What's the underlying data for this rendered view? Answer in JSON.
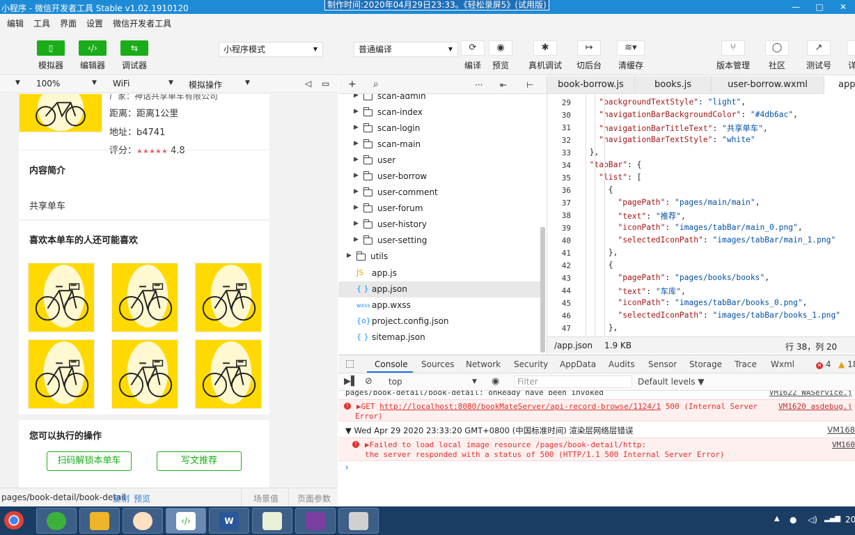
{
  "window": {
    "title": "小程序 - 微信开发者工具 Stable v1.02.1910120",
    "recording_banner": "制作时间:2020年04月29日23:33。《轻松录屏5》(试用版)",
    "controls": [
      "—",
      "□",
      "✕"
    ]
  },
  "menu": [
    "编辑",
    "工具",
    "界面",
    "设置",
    "微信开发者工具"
  ],
  "toolbar": {
    "simulator": "模拟器",
    "editor": "编辑器",
    "debugger": "调试器",
    "mode_select": "小程序模式",
    "compile_select": "普通编译",
    "compile": "编译",
    "preview": "预览",
    "remote_debug": "真机调试",
    "background": "切后台",
    "clear_cache": "清缓存",
    "version_mgmt": "版本管理",
    "community": "社区",
    "test_account": "测试号",
    "cut": "详"
  },
  "simbar": {
    "zoom": "100%",
    "network": "WiFi",
    "operation": "模拟操作"
  },
  "phone": {
    "top_partial": "厂家：神话共享单车有限公司",
    "distance": "距离：距离1公里",
    "address": "地址：b4741",
    "rating_label": "评分：",
    "rating_stars": "★★★★★",
    "rating_value": "4.8",
    "intro_title": "内容简介",
    "intro_text": "共享单车",
    "like_title": "喜欢本单车的人还可能喜欢",
    "actions_title": "您可以执行的操作",
    "btn_unlock": "扫码解锁本单车",
    "btn_write": "写文推荐",
    "brand_color": "#ffd900"
  },
  "simstatus": {
    "path": "pages/book-detail/book-detail",
    "copy": "复制",
    "preview": "预览",
    "scene": "场景值",
    "params": "页面参数"
  },
  "tree": {
    "toolbar_add": "+",
    "toolbar_search": "⌕",
    "toolbar_more": "···",
    "items": [
      {
        "name": "scan-admin",
        "type": "folder"
      },
      {
        "name": "scan-index",
        "type": "folder"
      },
      {
        "name": "scan-login",
        "type": "folder"
      },
      {
        "name": "scan-main",
        "type": "folder"
      },
      {
        "name": "user",
        "type": "folder"
      },
      {
        "name": "user-borrow",
        "type": "folder"
      },
      {
        "name": "user-comment",
        "type": "folder"
      },
      {
        "name": "user-forum",
        "type": "folder"
      },
      {
        "name": "user-history",
        "type": "folder"
      },
      {
        "name": "user-setting",
        "type": "folder"
      },
      {
        "name": "utils",
        "type": "folder"
      },
      {
        "name": "app.js",
        "type": "js",
        "icon": "JS"
      },
      {
        "name": "app.json",
        "type": "json",
        "icon": "{ }"
      },
      {
        "name": "app.wxss",
        "type": "wxss",
        "icon": "wxss"
      },
      {
        "name": "project.config.json",
        "type": "json",
        "icon": "{o}"
      },
      {
        "name": "sitemap.json",
        "type": "json",
        "icon": "{ }"
      }
    ]
  },
  "editor": {
    "tabs": [
      "book-borrow.js",
      "books.js",
      "user-borrow.wxml",
      "app"
    ],
    "lines": [
      {
        "n": "29",
        "indent": 2,
        "k": "\"backgroundTextStyle\"",
        "v": "\"light\"",
        "tail": ","
      },
      {
        "n": "30",
        "indent": 2,
        "k": "\"navigationBarBackgroundColor\"",
        "v": "\"#4db6ac\"",
        "tail": ","
      },
      {
        "n": "31",
        "indent": 2,
        "k": "\"navigationBarTitleText\"",
        "v": "\"共享单车\"",
        "tail": ","
      },
      {
        "n": "32",
        "indent": 2,
        "k": "\"navigationBarTextStyle\"",
        "v": "\"white\"",
        "tail": ""
      },
      {
        "n": "33",
        "indent": 1,
        "k": "",
        "v": "",
        "tail": "},"
      },
      {
        "n": "34",
        "indent": 1,
        "k": "\"tabBar\"",
        "v": "",
        "tail": "{"
      },
      {
        "n": "35",
        "indent": 2,
        "k": "\"list\"",
        "v": "",
        "tail": "["
      },
      {
        "n": "36",
        "indent": 3,
        "k": "",
        "v": "",
        "tail": "{"
      },
      {
        "n": "37",
        "indent": 4,
        "k": "\"pagePath\"",
        "v": "\"pages/main/main\"",
        "tail": ","
      },
      {
        "n": "38",
        "indent": 4,
        "k": "\"text\"",
        "v": "\"推荐\"",
        "tail": ","
      },
      {
        "n": "39",
        "indent": 4,
        "k": "\"iconPath\"",
        "v": "\"images/tabBar/main_0.png\"",
        "tail": ","
      },
      {
        "n": "40",
        "indent": 4,
        "k": "\"selectedIconPath\"",
        "v": "\"images/tabBar/main_1.png\"",
        "tail": ""
      },
      {
        "n": "41",
        "indent": 3,
        "k": "",
        "v": "",
        "tail": "},"
      },
      {
        "n": "42",
        "indent": 3,
        "k": "",
        "v": "",
        "tail": "{"
      },
      {
        "n": "43",
        "indent": 4,
        "k": "\"pagePath\"",
        "v": "\"pages/books/books\"",
        "tail": ","
      },
      {
        "n": "44",
        "indent": 4,
        "k": "\"text\"",
        "v": "\"车库\"",
        "tail": ","
      },
      {
        "n": "45",
        "indent": 4,
        "k": "\"iconPath\"",
        "v": "\"images/tabBar/books_0.png\"",
        "tail": ","
      },
      {
        "n": "46",
        "indent": 4,
        "k": "\"selectedIconPath\"",
        "v": "\"images/tabBar/books_1.png\"",
        "tail": ""
      },
      {
        "n": "47",
        "indent": 3,
        "k": "",
        "v": "",
        "tail": "},"
      }
    ],
    "status_file": "/app.json",
    "status_size": "1.9 KB",
    "status_pos": "行 38，列 20"
  },
  "devtools": {
    "tabs": [
      "Console",
      "Sources",
      "Network",
      "Security",
      "AppData",
      "Audits",
      "Sensor",
      "Storage",
      "Trace",
      "Wxml"
    ],
    "error_count": "4",
    "warn_count": "18",
    "context": "top",
    "filter_placeholder": "Filter",
    "levels": "Default levels ▼",
    "console": [
      {
        "type": "info",
        "text": "pages/book-detail/book-detail: onReady have been invoked",
        "src": "VM1622 WAService.j"
      },
      {
        "type": "error",
        "prefix": "▶GET ",
        "url": "http://localhost:8080/bookMateServer/api-record-browse/1124/1",
        "text": " 500 (Internal Server",
        "text2": "Error)",
        "src": "VM1620 asdebug.j"
      },
      {
        "type": "group",
        "text": "▼ Wed Apr 29 2020 23:33:20 GMT+0800 (中国标准时间) 渲染层网络层错误",
        "src": "VM168"
      },
      {
        "type": "error2",
        "text": "▶Failed to load local image resource /pages/book-detail/http:",
        "text2": " the server responded with a status of 500 (HTTP/1.1 500 Internal Server Error)",
        "src": "VM160"
      }
    ],
    "prompt": "›"
  },
  "taskbar": {
    "clock": "20"
  }
}
